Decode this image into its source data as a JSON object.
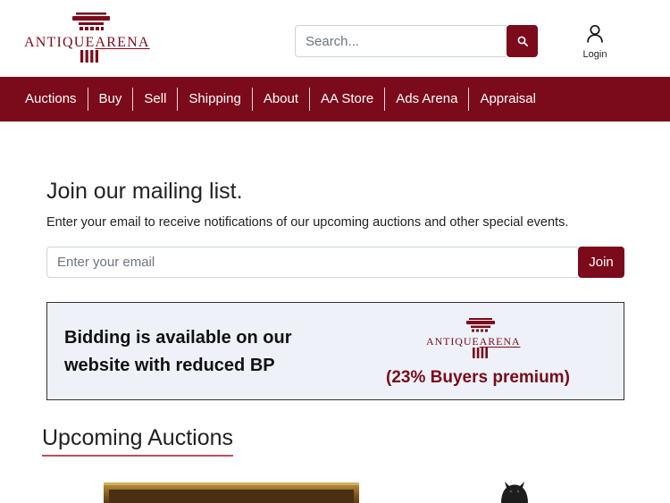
{
  "brand": {
    "name_left": "ANTIQUE",
    "name_right": "ARENA",
    "color": "#7b0a1a"
  },
  "search": {
    "placeholder": "Search...",
    "icon": "search-icon"
  },
  "login": {
    "label": "Login",
    "icon": "user-icon"
  },
  "nav": {
    "items": [
      "Auctions",
      "Buy",
      "Sell",
      "Shipping",
      "About",
      "AA Store",
      "Ads Arena",
      "Appraisal"
    ]
  },
  "mailing": {
    "title": "Join our mailing list.",
    "description": "Enter your email to receive notifications of our upcoming auctions and other special events.",
    "email_placeholder": "Enter your email",
    "join_label": "Join"
  },
  "promo": {
    "text": "Bidding is available on our website with reduced BP",
    "premium": "(23% Buyers premium)"
  },
  "upcoming": {
    "title": "Upcoming Auctions"
  }
}
